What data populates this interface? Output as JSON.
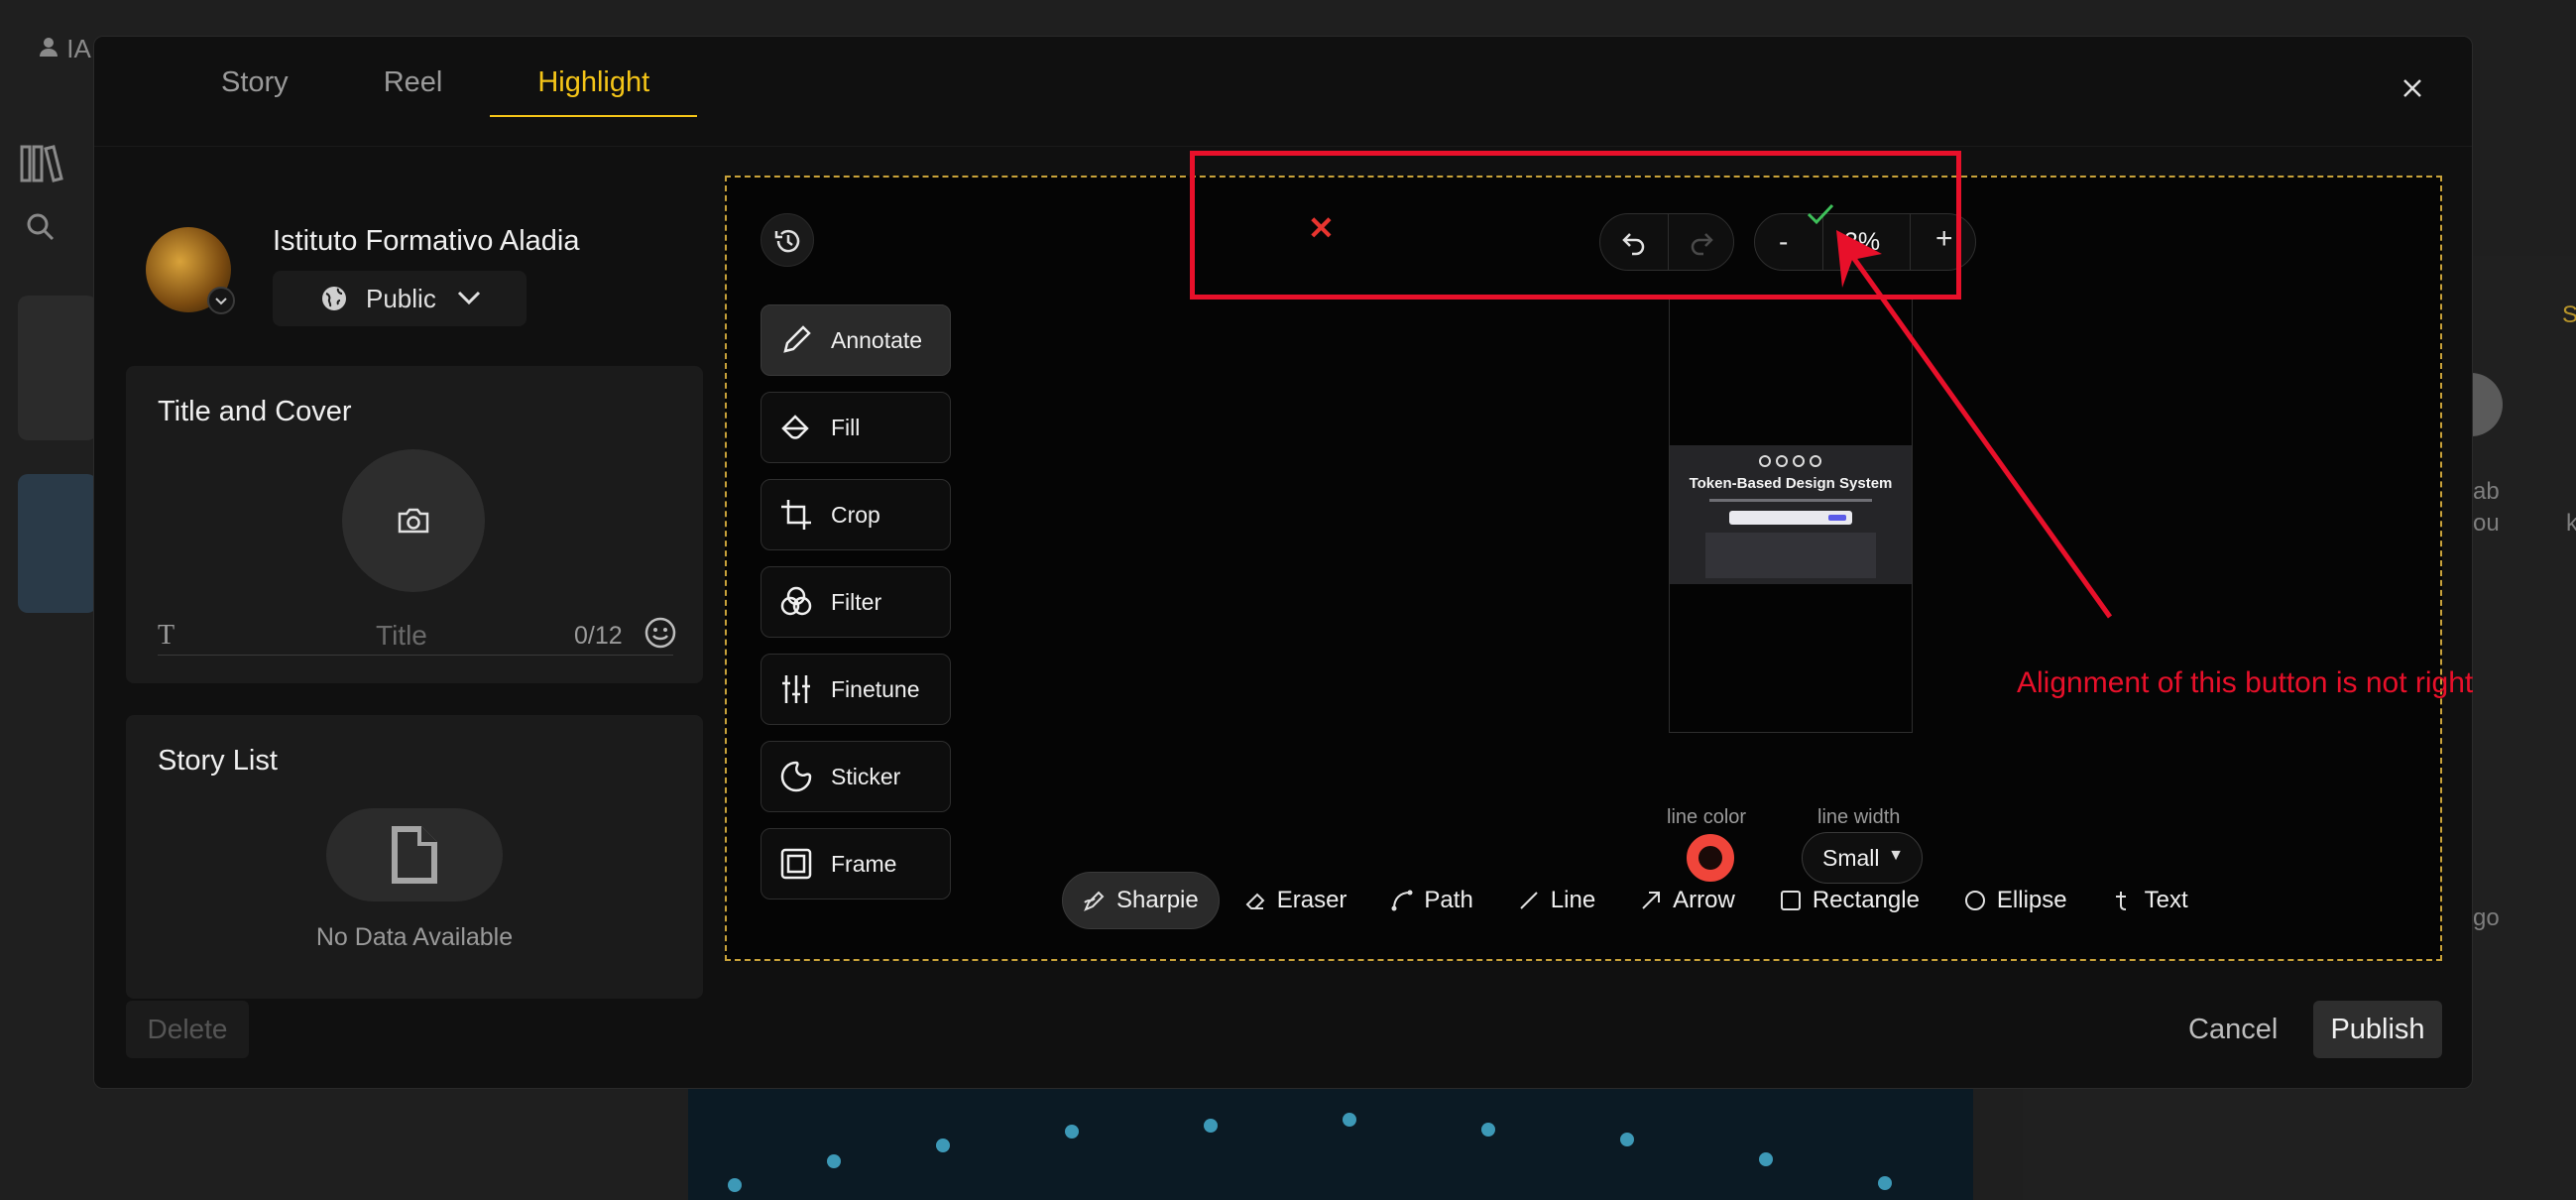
{
  "background": {
    "user_initials": "IA",
    "right_text_1": "ab",
    "right_text_2": "ou",
    "right_text_3": "k",
    "right_text_4": "go",
    "right_text_5": "S"
  },
  "tabs": [
    {
      "label": "Story"
    },
    {
      "label": "Reel"
    },
    {
      "label": "Highlight"
    }
  ],
  "profile": {
    "name": "Istituto Formativo Aladia",
    "visibility": "Public"
  },
  "title_cover": {
    "heading": "Title and Cover",
    "title_placeholder": "Title",
    "char_count": "0/12"
  },
  "story_list": {
    "heading": "Story List",
    "empty_text": "No Data Available"
  },
  "tools": [
    {
      "label": "Annotate"
    },
    {
      "label": "Fill"
    },
    {
      "label": "Crop"
    },
    {
      "label": "Filter"
    },
    {
      "label": "Finetune"
    },
    {
      "label": "Sticker"
    },
    {
      "label": "Frame"
    }
  ],
  "zoom": {
    "minus": "-",
    "value": "3%",
    "plus": "+"
  },
  "cancel_x": "✕",
  "preview": {
    "title": "Token-Based Design System"
  },
  "line_color_label": "line color",
  "line_width_label": "line width",
  "line_width_value": "Small",
  "shapes": [
    {
      "label": "Sharpie"
    },
    {
      "label": "Eraser"
    },
    {
      "label": "Path"
    },
    {
      "label": "Line"
    },
    {
      "label": "Arrow"
    },
    {
      "label": "Rectangle"
    },
    {
      "label": "Ellipse"
    },
    {
      "label": "Text"
    }
  ],
  "footer": {
    "delete": "Delete",
    "cancel": "Cancel",
    "publish": "Publish"
  },
  "annotation": {
    "text": "Alignment of this button is not right",
    "color": "#e8102a"
  },
  "colors": {
    "accent": "#f5c518",
    "line_color": "#f0453a",
    "confirm_check": "#3ec15a"
  }
}
